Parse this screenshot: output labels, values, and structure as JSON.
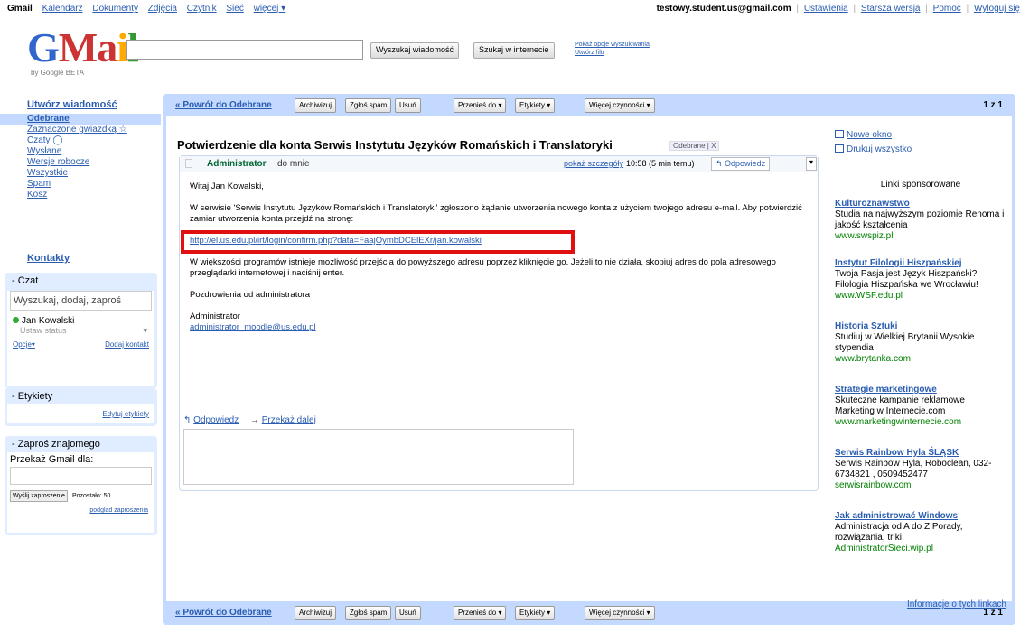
{
  "topbar": {
    "links": [
      "Gmail",
      "Kalendarz",
      "Dokumenty",
      "Zdjęcia",
      "Czytnik",
      "Sieć",
      "więcej ▾"
    ],
    "email": "testowy.student.us@gmail.com",
    "right_links": [
      "Ustawienia",
      "Starsza wersja",
      "Pomoc",
      "Wyloguj się"
    ]
  },
  "logo": {
    "text": "Gmail",
    "sub": "by Google   BETA"
  },
  "search": {
    "input_value": "",
    "mail_button": "Wyszukaj wiadomość",
    "web_button": "Szukaj w internecie",
    "options_link": "Pokaż opcje wyszukiwania",
    "filter_link": "Utwórz filtr"
  },
  "leftnav": {
    "compose": "Utwórz wiadomość",
    "folders": [
      "Odebrane",
      "Zaznaczone gwiazdką ☆",
      "Czaty ◯",
      "Wysłane",
      "Wersje robocze",
      "Wszystkie",
      "Spam",
      "Kosz"
    ],
    "contacts": "Kontakty"
  },
  "chat": {
    "title": "- Czat",
    "search": "Wyszukaj, dodaj, zaproś",
    "user": "Jan Kowalski",
    "status": "Ustaw status",
    "options": "Opcje▾",
    "add_contact": "Dodaj kontakt"
  },
  "labels": {
    "title": "- Etykiety",
    "edit": "Edytuj etykiety"
  },
  "invite": {
    "title": "- Zaproś znajomego",
    "label": "Przekaż Gmail dla:",
    "send": "Wyślij zaproszenie",
    "remaining": "Pozostało: 50",
    "preview": "podgląd zaproszenia"
  },
  "toolbar": {
    "back": "« Powrót do Odebrane",
    "archive": "Archiwizuj",
    "spam": "Zgłoś spam",
    "delete": "Usuń",
    "move": "Przenieś do ▾",
    "labels": "Etykiety ▾",
    "more": "Więcej czynności ▾",
    "paging": "1 z 1"
  },
  "message": {
    "subject": "Potwierdzenie dla konta Serwis Instytutu Języków Romańskich i Translatoryki",
    "label_chip": "Odebrane | X",
    "from": "Administrator",
    "to": "do mnie",
    "show_details": "pokaż szczegóły",
    "time": "10:58 (5 min temu)",
    "reply_button": "↰ Odpowiedz",
    "more_button": "▾",
    "greeting": "Witaj Jan Kowalski,",
    "para1": "W serwisie 'Serwis Instytutu Języków Romańskich i Translatoryki' zgłoszono żądanie utworzenia nowego konta z użyciem twojego adresu e-mail. Aby potwierdzić zamiar utworzenia konta przejdź na stronę:",
    "confirm_link": "http://el.us.edu.pl/irt/login/confirm.php?data=FaajOymbDCElEXr/jan.kowalski",
    "para2": "W większości programów istnieje możliwość przejścia do powyższego adresu poprzez kliknięcie go. Jeżeli to nie działa, skopiuj adres do pola adresowego przeglądarki internetowej i naciśnij enter.",
    "regards": "Pozdrowienia od administratora",
    "signature_name": "Administrator",
    "signature_email": "administrator_moodle@us.edu.pl",
    "reply_link": "Odpowiedz",
    "forward_link": "Przekaż dalej"
  },
  "right": {
    "new_window": "Nowe okno",
    "print_all": "Drukuj wszystko",
    "sponsored": "Linki sponsorowane",
    "ads": [
      {
        "title": "Kulturoznawstwo",
        "desc": "Studia na najwyższym poziomie Renoma i jakość kształcenia",
        "url": "www.swspiz.pl"
      },
      {
        "title": "Instytut Filologii Hiszpańskiej",
        "desc": "Twoja Pasja jest Język Hiszpański? Filologia Hiszpańska we Wrocławiu!",
        "url": "www.WSF.edu.pl"
      },
      {
        "title": "Historia Sztuki",
        "desc": "Studiuj w Wielkiej Brytanii Wysokie stypendia",
        "url": "www.brytanka.com"
      },
      {
        "title": "Strategie marketingowe",
        "desc": "Skuteczne kampanie reklamowe Marketing w Internecie.com",
        "url": "www.marketingwinternecie.com"
      },
      {
        "title": "Serwis Rainbow Hyla ŚLĄSK",
        "desc": "Serwis Rainbow Hyla, Roboclean, 032-6734821 , 0509452477",
        "url": "serwisrainbow.com"
      },
      {
        "title": "Jak administrować Windows",
        "desc": "Administracja od A do Z Porady, rozwiązania, triki",
        "url": "AdministratorSieci.wip.pl"
      }
    ],
    "ads_info": "Informacje o tych linkach"
  },
  "colors": {
    "accent": "#c3d9ff",
    "link": "#2a5db0",
    "highlight": "#e01010",
    "sender": "#006633"
  }
}
